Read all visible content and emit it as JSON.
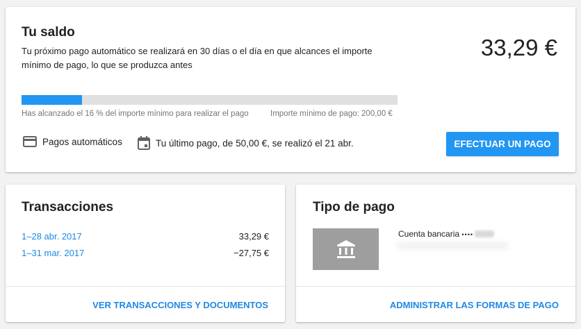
{
  "balance": {
    "title": "Tu saldo",
    "description": "Tu próximo pago automático se realizará en 30 días o el día en que alcances el importe mínimo de pago, lo que se produzca antes",
    "amount": "33,29 €",
    "progress_percent": 16,
    "progress_caption": "Has alcanzado el 16 % del importe mínimo para realizar el pago",
    "minimum_caption": "Importe mínimo de pago: 200,00 €",
    "autopay_label": "Pagos automáticos",
    "last_payment_label": "Tu último pago, de 50,00 €, se realizó el 21 abr.",
    "pay_button_label": "EFECTUAR UN PAGO"
  },
  "transactions": {
    "title": "Transacciones",
    "rows": [
      {
        "period": "1–28 abr. 2017",
        "amount": "33,29 €"
      },
      {
        "period": "1–31 mar. 2017",
        "amount": "−27,75 €"
      }
    ],
    "link_label": "VER TRANSACCIONES Y DOCUMENTOS"
  },
  "payment_type": {
    "title": "Tipo de pago",
    "bank_label": "Cuenta bancaria",
    "bank_mask": "••••",
    "link_label": "ADMINISTRAR LAS FORMAS DE PAGO"
  },
  "colors": {
    "accent": "#2196f3",
    "link": "#1e88e5",
    "track": "#e0e0e0",
    "bank_tile": "#9e9e9e"
  },
  "icons": {
    "autopay": "credit-card-icon",
    "last_payment": "calendar-icon",
    "bank": "bank-icon"
  }
}
